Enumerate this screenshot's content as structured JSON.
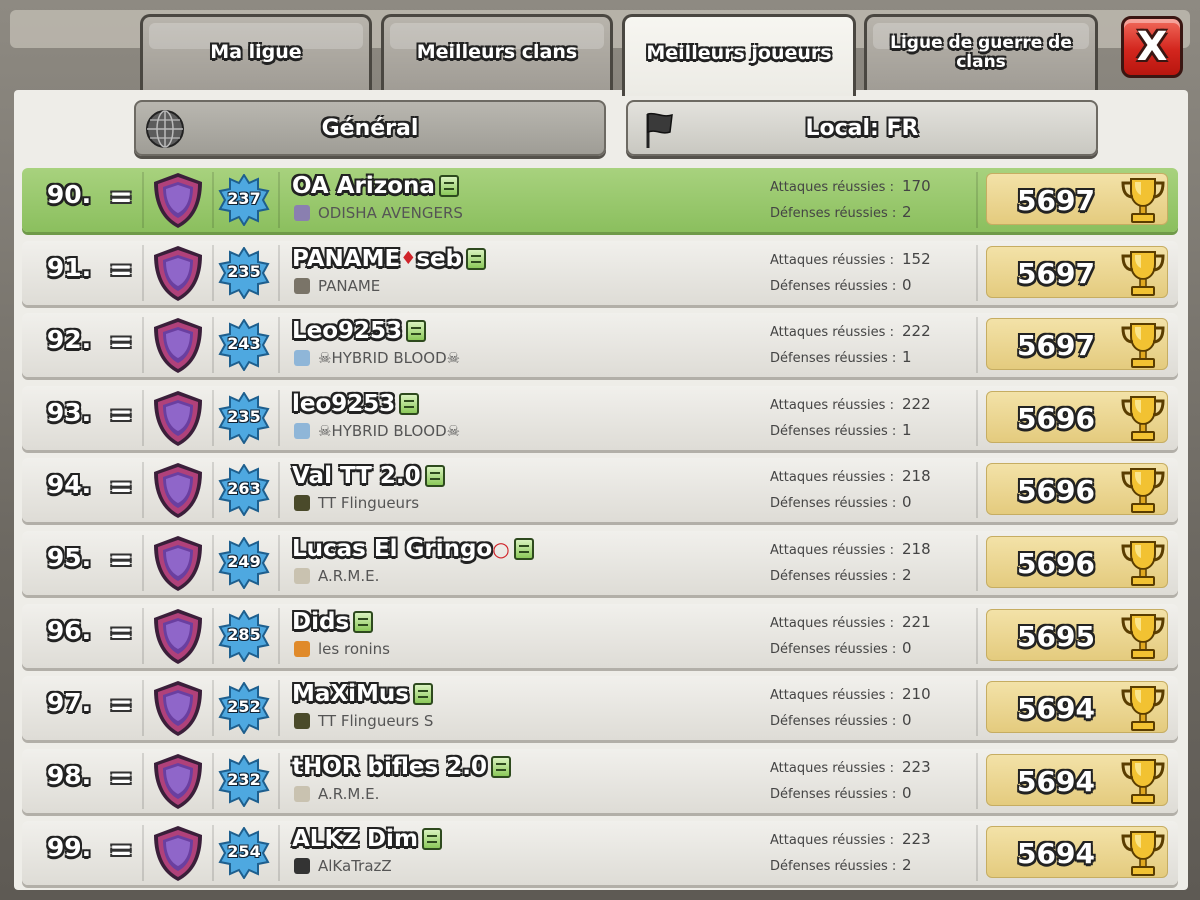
{
  "tabs": [
    {
      "label": "Ma ligue",
      "active": false
    },
    {
      "label": "Meilleurs clans",
      "active": false
    },
    {
      "label": "Meilleurs joueurs",
      "active": true
    },
    {
      "label": "Ligue de guerre de clans",
      "active": false
    }
  ],
  "close_label": "X",
  "filters": {
    "general": "Général",
    "local": "Local: FR"
  },
  "stat_labels": {
    "attacks": "Attaques réussies :",
    "defenses": "Défenses réussies :"
  },
  "colors": {
    "highlight_row": "#8bbf5e",
    "close_button": "#d3261e",
    "trophy_bg": "#e4cb7e"
  },
  "players": [
    {
      "rank": "90.",
      "trend": "=",
      "level": "237",
      "name": "OA Arizona",
      "marker": "",
      "clan": "ODISHA AVENGERS",
      "clan_color": "#8a7fb0",
      "attacks": "170",
      "defenses": "2",
      "trophies": "5697",
      "highlight": true
    },
    {
      "rank": "91.",
      "trend": "=",
      "level": "235",
      "name": "PANAME",
      "marker": "♦",
      "name2": "seb",
      "clan": "PANAME",
      "clan_color": "#7a7468",
      "attacks": "152",
      "defenses": "0",
      "trophies": "5697",
      "highlight": false
    },
    {
      "rank": "92.",
      "trend": "=",
      "level": "243",
      "name": "Leo9253",
      "marker": "",
      "clan": "☠HYBRID BLOOD☠",
      "clan_color": "#8fb6d8",
      "attacks": "222",
      "defenses": "1",
      "trophies": "5697",
      "highlight": false
    },
    {
      "rank": "93.",
      "trend": "=",
      "level": "235",
      "name": "leo9253",
      "marker": "",
      "clan": "☠HYBRID BLOOD☠",
      "clan_color": "#8fb6d8",
      "attacks": "222",
      "defenses": "1",
      "trophies": "5696",
      "highlight": false
    },
    {
      "rank": "94.",
      "trend": "=",
      "level": "263",
      "name": "Val TT 2.0",
      "marker": "",
      "clan": "TT Flingueurs",
      "clan_color": "#4a4a2a",
      "attacks": "218",
      "defenses": "0",
      "trophies": "5696",
      "highlight": false
    },
    {
      "rank": "95.",
      "trend": "=",
      "level": "249",
      "name": "Lucas El Gringo",
      "marker": "○",
      "clan": "A.R.M.E.",
      "clan_color": "#c9c2b0",
      "attacks": "218",
      "defenses": "2",
      "trophies": "5696",
      "highlight": false
    },
    {
      "rank": "96.",
      "trend": "=",
      "level": "285",
      "name": "Dids",
      "marker": "",
      "clan": "les ronins",
      "clan_color": "#e08a2a",
      "attacks": "221",
      "defenses": "0",
      "trophies": "5695",
      "highlight": false
    },
    {
      "rank": "97.",
      "trend": "=",
      "level": "252",
      "name": "MaXiMus",
      "marker": "",
      "clan": "TT Flingueurs S",
      "clan_color": "#4a4a2a",
      "attacks": "210",
      "defenses": "0",
      "trophies": "5694",
      "highlight": false
    },
    {
      "rank": "98.",
      "trend": "=",
      "level": "232",
      "name": "tHOR bifles 2.0",
      "marker": "",
      "clan": "A.R.M.E.",
      "clan_color": "#c9c2b0",
      "attacks": "223",
      "defenses": "0",
      "trophies": "5694",
      "highlight": false
    },
    {
      "rank": "99.",
      "trend": "=",
      "level": "254",
      "name": "ALKZ Dim",
      "marker": "",
      "clan": "AlKaTrazZ",
      "clan_color": "#333333",
      "attacks": "223",
      "defenses": "2",
      "trophies": "5694",
      "highlight": false
    }
  ]
}
